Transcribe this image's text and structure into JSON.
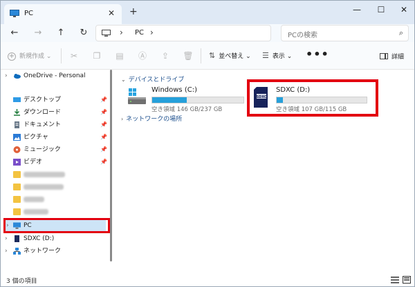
{
  "window": {
    "tab_title": "PC",
    "tab_close": "✕",
    "tab_add": "+",
    "minimize": "—",
    "maximize": "☐",
    "close": "✕"
  },
  "nav": {
    "back": "←",
    "forward": "→",
    "up": "↑",
    "refresh": "↻",
    "address_sep": "›",
    "address_crumb": "PC",
    "search_placeholder": "PCの検索",
    "search_icon": "⌕"
  },
  "toolbar": {
    "new_label": "新規作成",
    "new_caret": "⌄",
    "sort_label": "並べ替え",
    "sort_caret": "⌄",
    "view_label": "表示",
    "view_caret": "⌄",
    "more": "•••",
    "details_label": "詳細",
    "icons": [
      "cut-icon",
      "copy-icon",
      "paste-icon",
      "rename-icon",
      "share-icon",
      "delete-icon"
    ]
  },
  "sidebar": {
    "onedrive": "OneDrive - Personal",
    "quick_access": [
      {
        "label": "デスクトップ",
        "icon": "desktop-icon"
      },
      {
        "label": "ダウンロード",
        "icon": "download-icon"
      },
      {
        "label": "ドキュメント",
        "icon": "documents-icon"
      },
      {
        "label": "ピクチャ",
        "icon": "pictures-icon"
      },
      {
        "label": "ミュージック",
        "icon": "music-icon"
      },
      {
        "label": "ビデオ",
        "icon": "video-icon"
      }
    ],
    "pin": "📌",
    "pc_label": "PC",
    "sdxc_label": "SDXC (D:)",
    "network_label": "ネットワーク",
    "chevron": "›"
  },
  "main": {
    "group_devices": "デバイスとドライブ",
    "group_network": "ネットワークの場所",
    "group_caret": "⌄",
    "group_caret_collapsed": "›",
    "drives": [
      {
        "name": "Windows (C:)",
        "space": "空き領域 146 GB/237 GB",
        "used_fraction": 0.38
      },
      {
        "name": "SDXC (D:)",
        "space": "空き領域 107 GB/115 GB",
        "used_fraction": 0.07
      }
    ]
  },
  "status": {
    "count": "3 個の項目"
  },
  "colors": {
    "accent": "#26a0da",
    "highlight_red": "#e3000f",
    "selection": "#cde4f7",
    "folder": "#f3c341"
  }
}
